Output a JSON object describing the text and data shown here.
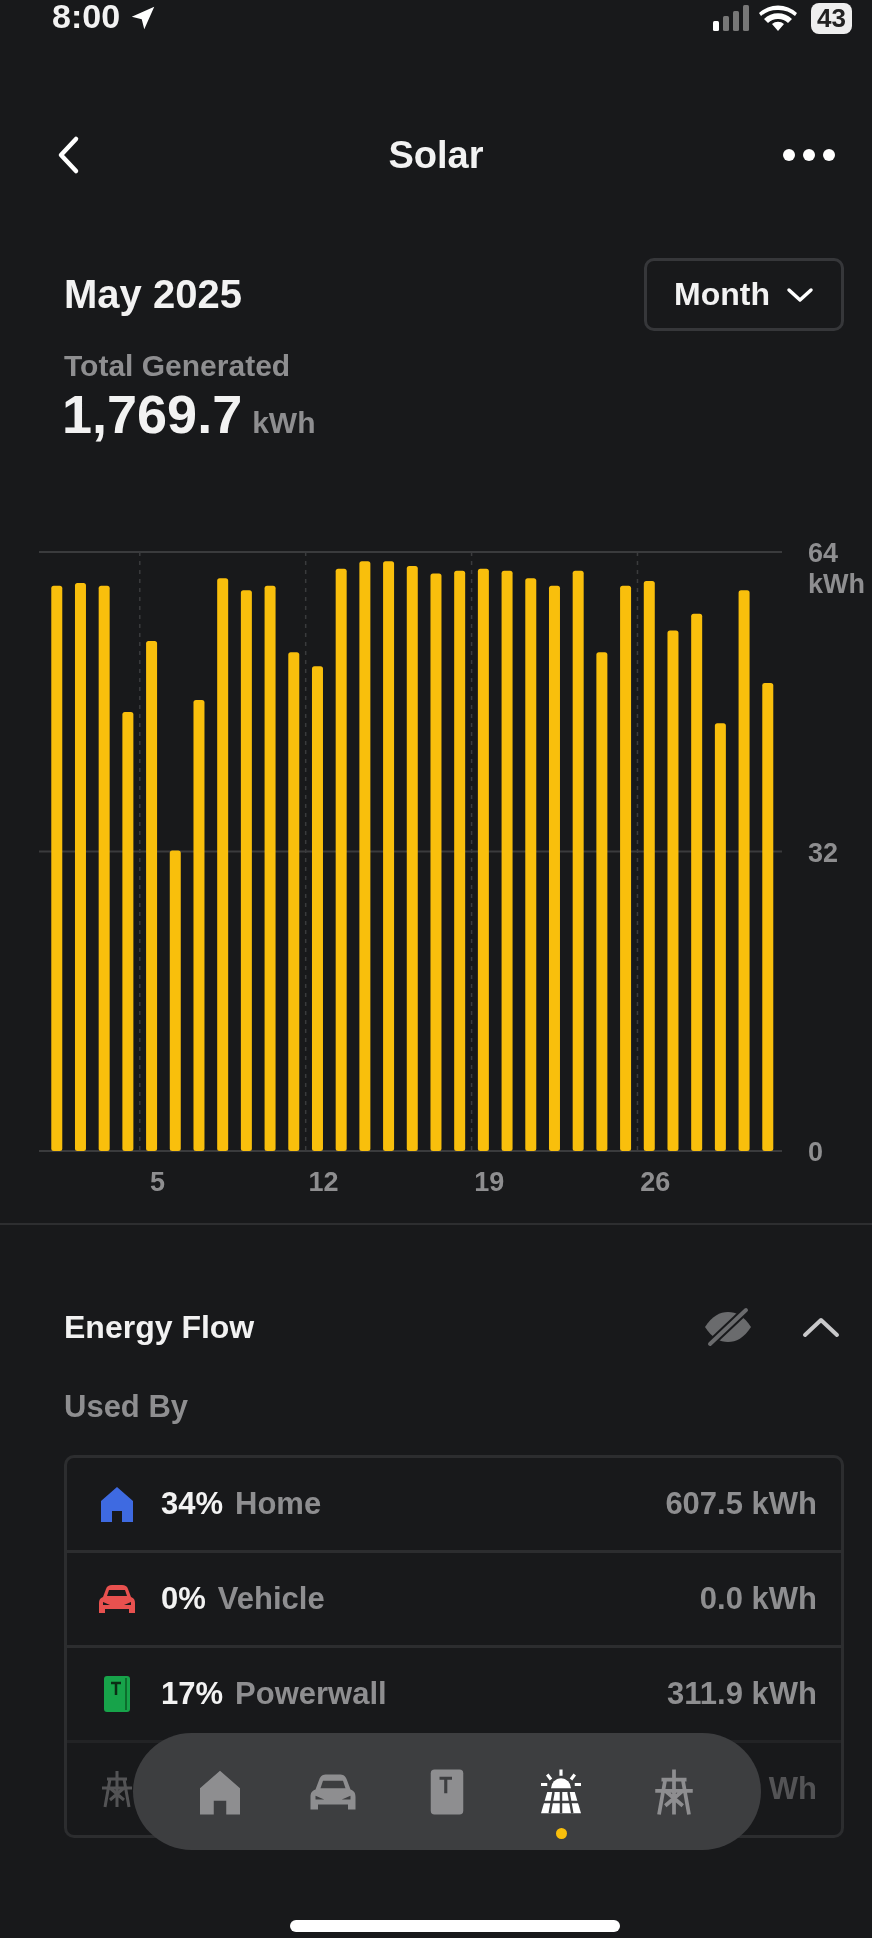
{
  "status_bar": {
    "time": "8:00",
    "battery": "43"
  },
  "header": {
    "title": "Solar"
  },
  "period": {
    "label": "May 2025",
    "dropdown": "Month"
  },
  "total": {
    "label": "Total Generated",
    "value": "1,769.7",
    "unit": "kWh"
  },
  "chart_data": {
    "type": "bar",
    "x": [
      1,
      2,
      3,
      4,
      5,
      6,
      7,
      8,
      9,
      10,
      11,
      12,
      13,
      14,
      15,
      16,
      17,
      18,
      19,
      20,
      21,
      22,
      23,
      24,
      25,
      26,
      27,
      28,
      29,
      30,
      31
    ],
    "series": [
      {
        "color": "#f9bf0c",
        "values": [
          60.4,
          60.7,
          60.4,
          46.9,
          54.5,
          32.1,
          48.2,
          61.2,
          59.9,
          60.4,
          53.3,
          51.8,
          62.2,
          63.0,
          63.0,
          62.5,
          61.7,
          62.0,
          62.2,
          62.0,
          61.2,
          60.4,
          62.0,
          53.3,
          60.4,
          60.9,
          55.6,
          57.4,
          45.7,
          59.9,
          50.0
        ]
      }
    ],
    "xlim": [
      0.25,
      31.6
    ],
    "ylim": [
      0,
      64
    ],
    "yticks": [
      0,
      32,
      {
        "value": 64,
        "label": "64 kWh"
      }
    ],
    "xticks": [
      5,
      12,
      19,
      26
    ]
  },
  "energy_flow": {
    "title": "Energy Flow",
    "section": "Used By",
    "rows": [
      {
        "kind": "home",
        "color": "#3e6ae1",
        "percent": "34%",
        "name": "Home",
        "amount": "607.5 kWh"
      },
      {
        "kind": "vehicle",
        "color": "#e8514f",
        "percent": "0%",
        "name": "Vehicle",
        "amount": "0.0 kWh"
      },
      {
        "kind": "powerwall",
        "color": "#17a34a",
        "percent": "17%",
        "name": "Powerwall",
        "amount": "311.9 kWh"
      },
      {
        "kind": "grid",
        "amount": "Wh"
      }
    ]
  },
  "nav": [
    {
      "kind": "home",
      "selected": false
    },
    {
      "kind": "vehicle",
      "selected": false
    },
    {
      "kind": "powerwall",
      "selected": false
    },
    {
      "kind": "solar",
      "selected": true
    },
    {
      "kind": "grid",
      "selected": false
    }
  ]
}
